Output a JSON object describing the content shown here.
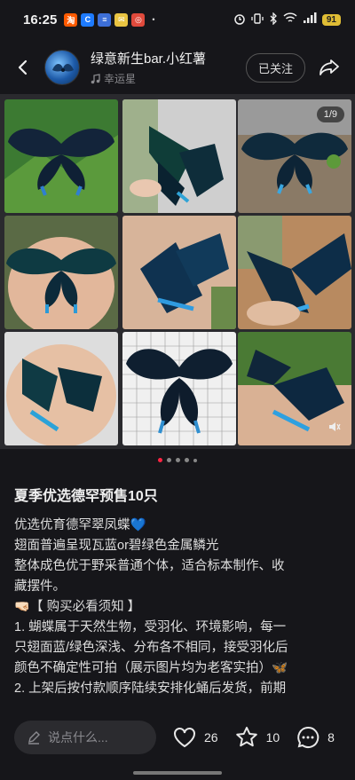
{
  "status_bar": {
    "time": "16:25",
    "apps": [
      {
        "label": "淘",
        "color": "#ff5a00"
      },
      {
        "label": "C",
        "color": "#1e7bff"
      },
      {
        "label": "≡",
        "color": "#3d6fd8"
      },
      {
        "label": "✉",
        "color": "#e9c442"
      },
      {
        "label": "◎",
        "color": "#e04a3c"
      }
    ],
    "more_dot": "•",
    "battery": "91"
  },
  "header": {
    "user_name": "绿意新生bar.小红薯",
    "subtitle": "幸运星",
    "follow_label": "已关注"
  },
  "gallery": {
    "page_indicator": "1/9",
    "photo_count": 9,
    "active_dot": 0,
    "dot_count": 5
  },
  "post": {
    "title": "夏季优选德罕预售10只",
    "lines": [
      "优选优育德罕翠凤蝶💙",
      "翅面普遍呈现瓦蓝or碧绿色金属鳞光",
      "整体成色优于野采普通个体，适合标本制作、收",
      "藏摆件。",
      "🤜🏻【 购买必看须知 】",
      "1. 蝴蝶属于天然生物，受羽化、环境影响，每一",
      "只翅面蓝/绿色深浅、分布各不相同，接受羽化后",
      "颜色不确定性可拍（展示图片均为老客实拍）🦋",
      "2. 上架后按付款顺序陆续安排化蛹后发货，前期"
    ]
  },
  "bottom_bar": {
    "comment_placeholder": "说点什么...",
    "likes": "26",
    "favorites": "10",
    "comments": "8"
  },
  "colors": {
    "accent": "#ff2442",
    "background": "#16161a"
  }
}
